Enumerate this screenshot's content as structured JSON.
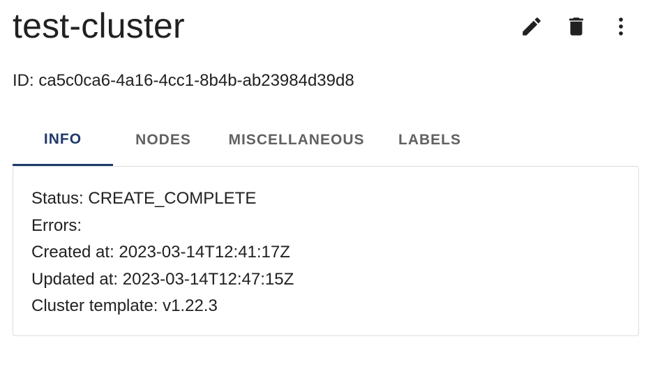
{
  "header": {
    "title": "test-cluster",
    "actions": [
      {
        "name": "edit",
        "icon": "pencil-icon"
      },
      {
        "name": "delete",
        "icon": "trash-icon"
      },
      {
        "name": "more",
        "icon": "more-vertical-icon"
      }
    ]
  },
  "cluster_id": {
    "label": "ID:",
    "value": "ca5c0ca6-4a16-4cc1-8b4b-ab23984d39d8"
  },
  "tabs": [
    {
      "label": "INFO",
      "active": true
    },
    {
      "label": "NODES",
      "active": false
    },
    {
      "label": "MISCELLANEOUS",
      "active": false
    },
    {
      "label": "LABELS",
      "active": false
    }
  ],
  "info": {
    "status": {
      "label": "Status:",
      "value": "CREATE_COMPLETE"
    },
    "errors": {
      "label": "Errors:",
      "value": ""
    },
    "created": {
      "label": "Created at:",
      "value": "2023-03-14T12:41:17Z"
    },
    "updated": {
      "label": "Updated at:",
      "value": "2023-03-14T12:47:15Z"
    },
    "template": {
      "label": "Cluster template:",
      "value": "v1.22.3"
    }
  },
  "colors": {
    "accent": "#1f3a6a",
    "text": "#212121",
    "tab_inactive": "#616161",
    "border": "#dcdcdc"
  }
}
